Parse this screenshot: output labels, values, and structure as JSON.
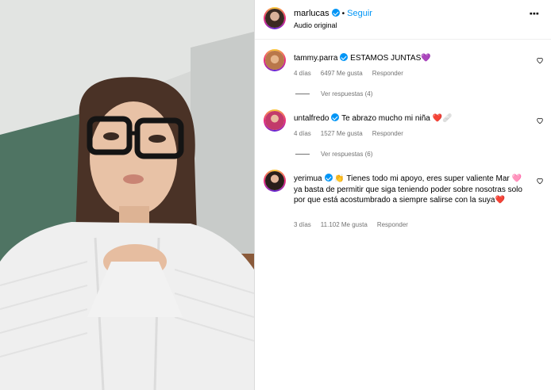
{
  "header": {
    "username": "marlucas",
    "separator": "•",
    "follow_label": "Seguir",
    "audio_label": "Audio original",
    "more_label": "⋮"
  },
  "comments": [
    {
      "user": "tammy.parra",
      "verified": true,
      "text": "ESTAMOS JUNTAS",
      "emoji": "💜",
      "age": "4 días",
      "likes": "6497 Me gusta",
      "reply_label": "Responder",
      "view_replies": "Ver respuestas (4)"
    },
    {
      "user": "untalfredo",
      "verified": true,
      "text": "Te abrazo mucho mi niña",
      "emoji": "❤️🩹",
      "age": "4 días",
      "likes": "1527 Me gusta",
      "reply_label": "Responder",
      "view_replies": "Ver respuestas (6)"
    },
    {
      "user": "yerimua",
      "verified": true,
      "text_lead": "👏 Tienes todo mi apoyo, eres super valiente",
      "text_rest": "Mar 🩷 ya basta de permitir que siga teniendo poder sobre nosotras solo por que está acostumbrado a siempre salirse con la suya",
      "emoji": "❤️",
      "age": "3 días",
      "likes": "11.102 Me gusta",
      "reply_label": "Responder"
    }
  ],
  "colors": {
    "accent_blue": "#0095f6",
    "meta_gray": "#737373"
  },
  "icons": [
    "verified-badge-icon",
    "heart-icon",
    "more-options-icon"
  ]
}
